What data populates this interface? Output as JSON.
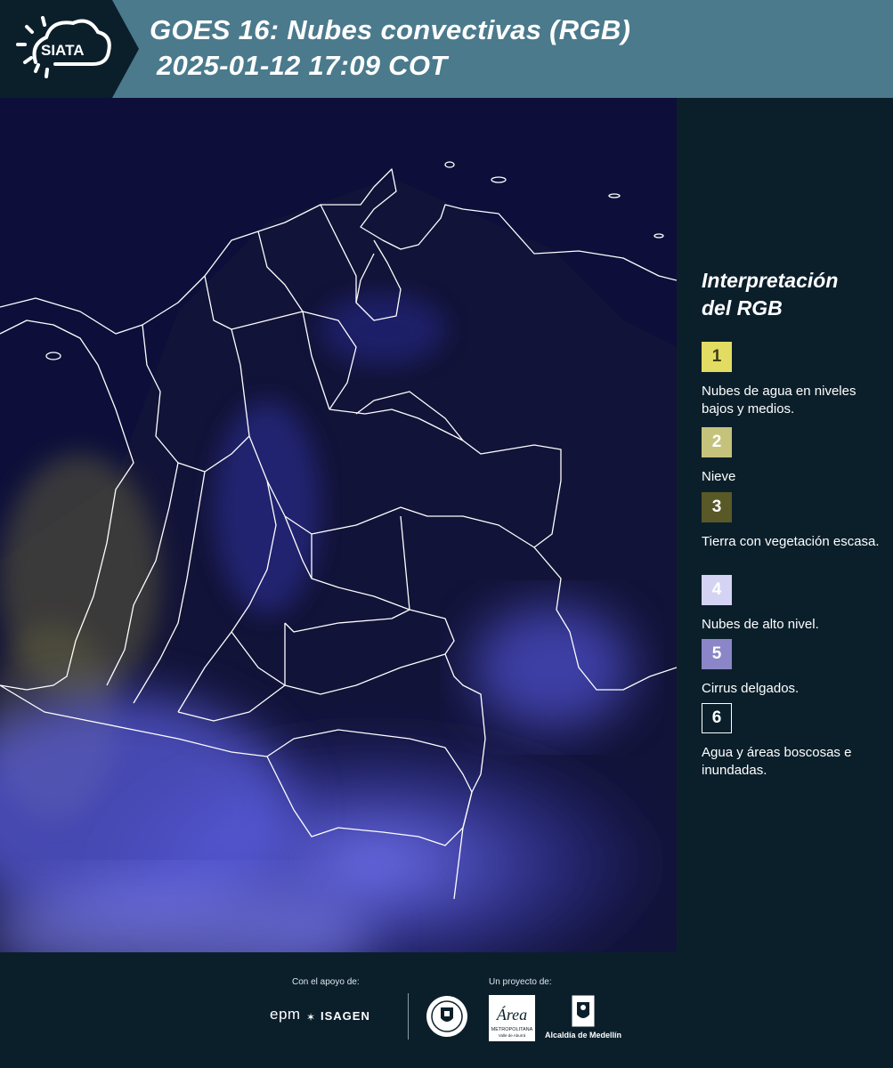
{
  "header": {
    "logo_text": "SIATA",
    "title_line1": "GOES 16: Nubes convectivas (RGB)",
    "title_line2": "2025-01-12 17:09 COT"
  },
  "legend": {
    "title_line1": "Interpretación",
    "title_line2": "del RGB",
    "items": [
      {
        "number": "1",
        "label": "Nubes de agua en niveles bajos y medios.",
        "color": "#e2dc62",
        "text_color": "#3c3c14"
      },
      {
        "number": "2",
        "label": "Nieve",
        "color": "#c5c27c",
        "text_color": "#ffffff"
      },
      {
        "number": "3",
        "label": "Tierra con vegetación escasa.",
        "color": "#595827",
        "text_color": "#ffffff"
      },
      {
        "number": "4",
        "label": "Nubes de alto nivel.",
        "color": "#d5d3f3",
        "text_color": "#ffffff"
      },
      {
        "number": "5",
        "label": "Cirrus delgados.",
        "color": "#8a86c7",
        "text_color": "#ffffff"
      },
      {
        "number": "6",
        "label": "Agua y áreas boscosas e inundadas.",
        "color": "#0b1f2b",
        "text_color": "#ffffff"
      }
    ]
  },
  "footer": {
    "support_label": "Con el apoyo de:",
    "project_label": "Un proyecto de:",
    "sponsor_epm": "epm",
    "sponsor_isagen": "ISAGEN",
    "partner_area_logo_text": "Área",
    "partner_area_text": "METROPOLITANA",
    "partner_area_subtext": "Valle de Aburrá",
    "partner_alcaldia": "Alcaldía de Medellín"
  },
  "colors": {
    "header_bg": "#4a7a8c",
    "page_bg": "#0b1f2b",
    "map_bg": "#0d0f3a",
    "border_lines": "#ffffff",
    "cloud_blue": "#5a5cf0"
  }
}
